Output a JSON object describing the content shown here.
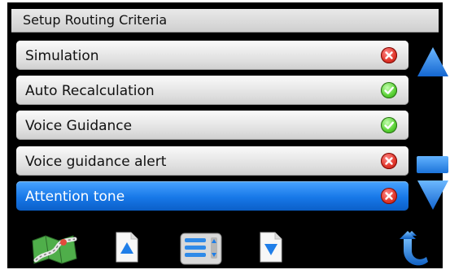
{
  "title": "Setup Routing Criteria",
  "items": [
    {
      "label": "Simulation",
      "status": "off",
      "status_icon": "disabled-x-icon"
    },
    {
      "label": "Auto Recalculation",
      "status": "on",
      "status_icon": "enabled-check-icon"
    },
    {
      "label": "Voice Guidance",
      "status": "on",
      "status_icon": "enabled-check-icon"
    },
    {
      "label": "Voice guidance alert",
      "status": "off",
      "status_icon": "disabled-x-icon"
    },
    {
      "label": "Attention tone",
      "status": "off",
      "status_icon": "disabled-x-icon",
      "selected": true
    }
  ],
  "toolbar": {
    "map_icon": "map-icon",
    "page_up_icon": "page-up-icon",
    "menu_icon": "list-menu-icon",
    "page_down_icon": "page-down-icon",
    "back_icon": "back-arrow-icon"
  },
  "colors": {
    "selected_row": "#1778e8",
    "toggle_on": "#5ad135",
    "toggle_off": "#e0362b",
    "scroll_arrow": "#2a88f0"
  }
}
